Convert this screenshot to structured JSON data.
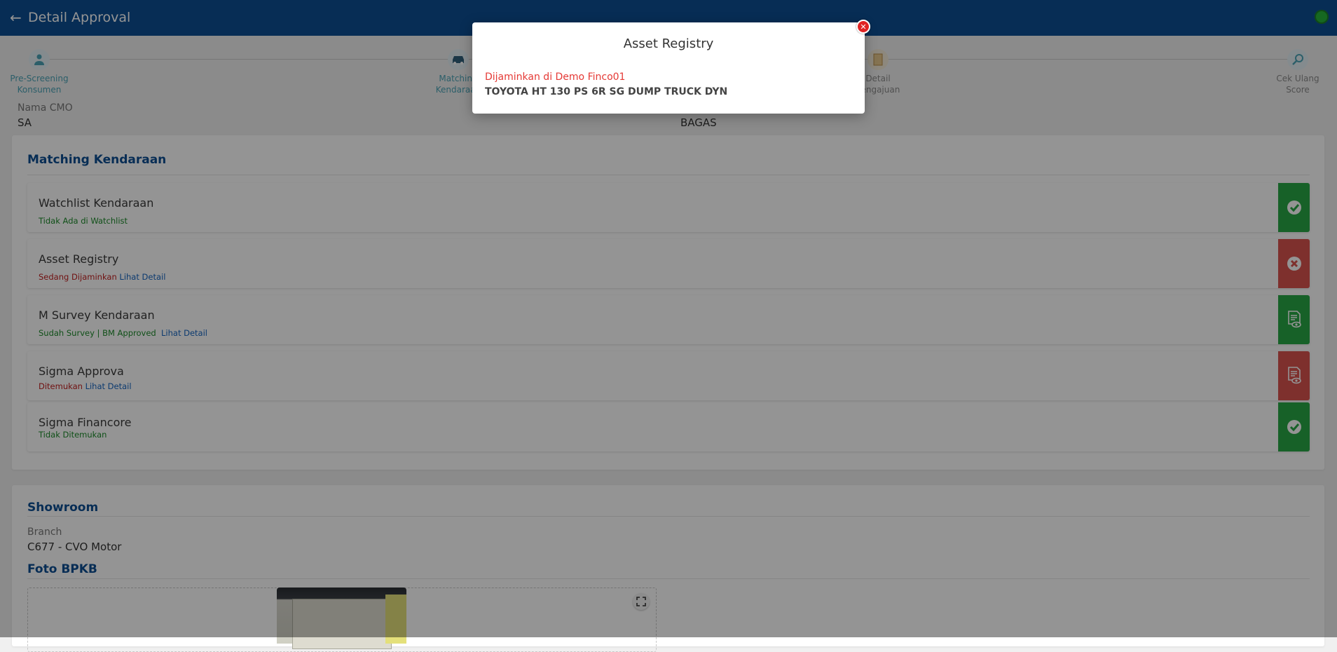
{
  "header": {
    "title": "Detail Approval",
    "back_icon": "arrow-left-icon",
    "status_color": "#27b339"
  },
  "stepper": {
    "steps": [
      {
        "label_line1": "Pre-Screening",
        "label_line2": "Konsumen",
        "icon": "user-check-icon"
      },
      {
        "label_line1": "Matching",
        "label_line2": "Kendaraan",
        "icon": "car-icon"
      },
      {
        "label_line1": "Detail",
        "label_line2": "Pengajuan",
        "icon": "document-icon"
      },
      {
        "label_line1": "Cek Ulang",
        "label_line2": "Score",
        "icon": "magnifier-icon"
      }
    ]
  },
  "cmo": {
    "label": "Nama CMO",
    "value": "SA",
    "value2": "BAGAS"
  },
  "matching": {
    "title": "Matching Kendaraan",
    "rows": [
      {
        "name": "Watchlist Kendaraan",
        "status": "Tidak Ada di Watchlist",
        "link": "",
        "status_icon": "check-circle-icon"
      },
      {
        "name": "Asset Registry",
        "status": "Sedang Dijaminkan",
        "link": "Lihat Detail",
        "status_icon": "x-circle-icon"
      },
      {
        "name": "M Survey Kendaraan",
        "status": "Sudah Survey | BM Approved",
        "link": "Lihat Detail",
        "status_icon": "document-eye-icon"
      },
      {
        "name": "Sigma Approva",
        "status": "Ditemukan",
        "link": "Lihat Detail",
        "status_icon": "document-eye-icon"
      },
      {
        "name": "Sigma Financore",
        "status": "Tidak Ditemukan",
        "link": "",
        "status_icon": "check-circle-icon"
      }
    ]
  },
  "showroom": {
    "title": "Showroom",
    "branch_label": "Branch",
    "branch_value": "C677 - CVO Motor",
    "photo_title": "Foto BPKB"
  },
  "modal": {
    "title": "Asset Registry",
    "line1": "Dijaminkan di Demo Finco01",
    "line2": "TOYOTA HT 130 PS 6R SG DUMP TRUCK DYN"
  }
}
